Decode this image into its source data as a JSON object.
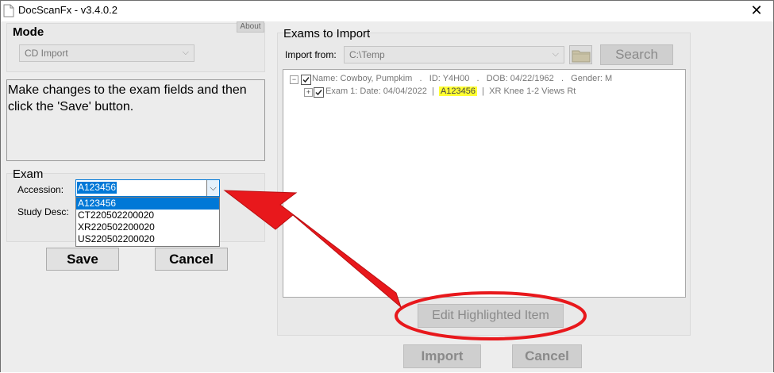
{
  "window": {
    "title": "DocScanFx  -  v3.4.0.2",
    "close_glyph": "✕"
  },
  "mode": {
    "title": "Mode",
    "about_label": "About",
    "selected": "CD Import",
    "arrow": "⌵"
  },
  "message": {
    "text": "Make changes to the exam fields and then click the 'Save' button."
  },
  "exam": {
    "title": "Exam",
    "accession_label": "Accession:",
    "accession_value": "A123456",
    "study_desc_label": "Study Desc:",
    "dropdown_arrow": "⌵",
    "options": [
      "A123456",
      "CT220502200020",
      "XR220502200020",
      "US220502200020"
    ],
    "save_label": "Save",
    "cancel_label": "Cancel"
  },
  "exams_to_import": {
    "title": "Exams to Import",
    "import_from_label": "Import from:",
    "import_from_value": "C:\\Temp",
    "arrow": "⌵",
    "search_label": "Search",
    "tree": {
      "patient": {
        "expander": "−",
        "name_label": "Name:",
        "name": "Cowboy, Pumpkim",
        "id_label": "ID:",
        "id": "Y4H00",
        "dob_label": "DOB:",
        "dob": "04/22/1962",
        "gender_label": "Gender:",
        "gender": "M",
        "sep": "."
      },
      "exam": {
        "expander": "+",
        "label": "Exam 1:",
        "date_label": "Date:",
        "date": "04/04/2022",
        "pipe": "|",
        "accession": "A123456",
        "description": "XR Knee 1-2 Views Rt"
      }
    },
    "edit_label": "Edit Highlighted Item",
    "import_label": "Import",
    "cancel_label": "Cancel"
  },
  "colors": {
    "annotation_red": "#e8181c",
    "highlight": "#ffff33",
    "selection_blue": "#0078d7"
  }
}
